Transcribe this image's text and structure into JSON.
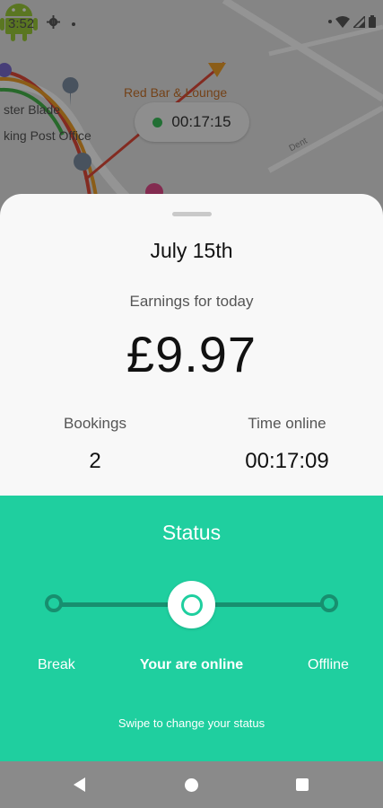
{
  "status_bar": {
    "time": "3:52"
  },
  "map": {
    "labels": {
      "place1": "Red Bar & Lounge",
      "place2": "ster Blade",
      "place3": "king Post Office",
      "road": "Dent"
    },
    "timer": "00:17:15"
  },
  "summary": {
    "date": "July 15th",
    "earnings_label": "Earnings for today",
    "earnings_value": "£9.97",
    "bookings_label": "Bookings",
    "bookings_value": "2",
    "time_online_label": "Time online",
    "time_online_value": "00:17:09"
  },
  "status": {
    "title": "Status",
    "options": {
      "break": "Break",
      "online": "Your are online",
      "offline": "Offline"
    },
    "selected": "online",
    "hint": "Swipe to change your status"
  },
  "colors": {
    "accent": "#1fcf9f",
    "track": "#178f6f",
    "timer_dot": "#3bbf5b"
  },
  "icons": {
    "status_bar": [
      "gear-icon",
      "wifi-icon",
      "signal-icon",
      "battery-icon"
    ],
    "nav": [
      "back-icon",
      "home-icon",
      "recents-icon"
    ]
  }
}
